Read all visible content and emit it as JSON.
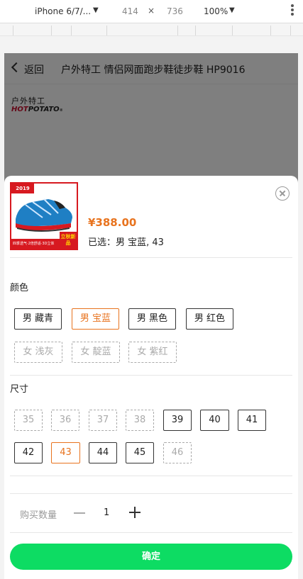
{
  "devtools": {
    "device": "iPhone 6/7/...",
    "width": "414",
    "times": "×",
    "height": "736",
    "zoom": "100%"
  },
  "nav": {
    "back_label": "返回",
    "title": "户外特工 情侣网面跑步鞋徒步鞋 HP9016"
  },
  "brand": {
    "cn": "户外特工",
    "en_part1": "HOT",
    "en_part2": "POTATO"
  },
  "product": {
    "thumb_year": "2019",
    "thumb_strip": "四季透气·2倍舒适·3D立体",
    "thumb_badge": "立秋新品",
    "price": "¥388.00",
    "selected": "已选：男 宝蓝, 43"
  },
  "color": {
    "label": "颜色",
    "options": [
      "男 藏青",
      "男 宝蓝",
      "男 黑色",
      "男 红色",
      "女 浅灰",
      "女 靛蓝",
      "女 紫红"
    ],
    "selected": "男 宝蓝",
    "disabled": [
      "女 浅灰",
      "女 靛蓝",
      "女 紫红"
    ]
  },
  "size": {
    "label": "尺寸",
    "options": [
      "35",
      "36",
      "37",
      "38",
      "39",
      "40",
      "41",
      "42",
      "43",
      "44",
      "45",
      "46"
    ],
    "selected": "43",
    "disabled": [
      "35",
      "36",
      "37",
      "38",
      "46"
    ]
  },
  "quantity": {
    "label": "购买数量",
    "value": "1"
  },
  "confirm_label": "确定",
  "colors": {
    "accent": "#e8731e",
    "confirm": "#0ddc63"
  }
}
